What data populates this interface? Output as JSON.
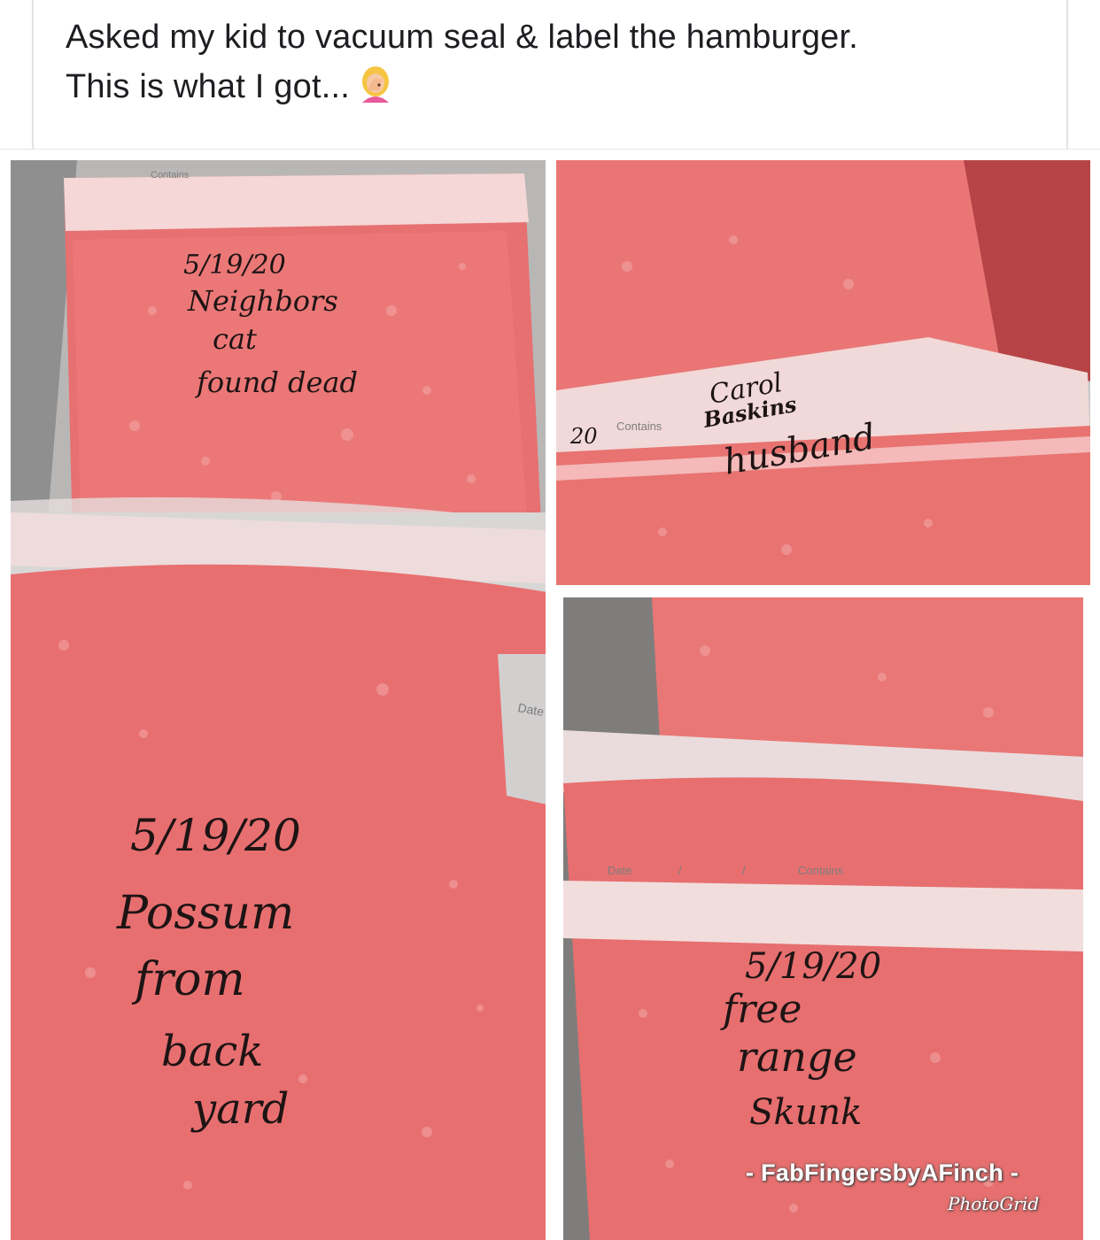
{
  "post": {
    "caption_line1": "Asked my kid to vacuum seal & label the hamburger.",
    "caption_line2": "This is what I got...",
    "emoji": "woman-facepalming-icon"
  },
  "photos": [
    {
      "label_lines": [
        "5/19/20",
        "Neighbors",
        "cat",
        "found dead"
      ],
      "printed_text": [
        "Contains"
      ]
    },
    {
      "label_lines": [
        "20",
        "Carol",
        "Baskins",
        "husband"
      ],
      "printed_text": [
        "Contains"
      ]
    },
    {
      "label_lines": [
        "5/19/20",
        "Possum",
        "from",
        "back",
        "yard"
      ],
      "printed_text": [
        "Date"
      ]
    },
    {
      "label_lines": [
        "5/19/20",
        "free",
        "range",
        "Skunk"
      ],
      "printed_text": [
        "Date",
        "/",
        "/",
        "Contains"
      ]
    }
  ],
  "watermark": {
    "main": "- FabFingersbyAFinch -",
    "sub": "PhotoGrid"
  },
  "colors": {
    "meat": "#e8706f",
    "meat_light": "#f1a3a2",
    "plastic": "#d8d8d8",
    "caption_text": "#1c1e21"
  }
}
